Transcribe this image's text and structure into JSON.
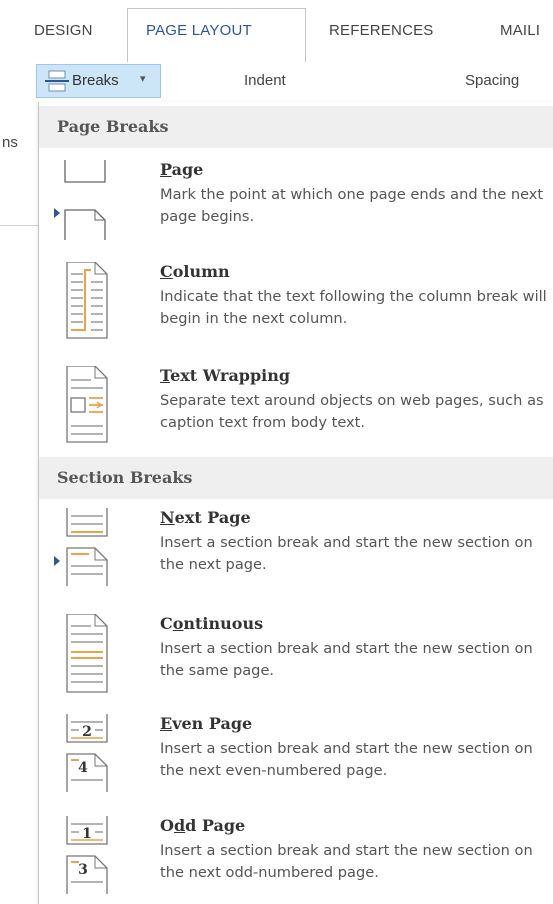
{
  "ribbon": {
    "tabs": [
      {
        "label": "DESIGN"
      },
      {
        "label": "PAGE LAYOUT"
      },
      {
        "label": "REFERENCES"
      },
      {
        "label": "MAILI"
      }
    ],
    "breaks_label": "Breaks",
    "breaks_caret": "▾",
    "indent_label": "Indent",
    "spacing_label": "Spacing",
    "left_cut_text": "ns"
  },
  "menu": {
    "page_breaks_header": "Page Breaks",
    "section_breaks_header": "Section Breaks",
    "items": [
      {
        "title_u": "P",
        "title_rest": "age",
        "desc": "Mark the point at which one page ends and the next page begins.",
        "icon": "page-break-icon"
      },
      {
        "title_u": "C",
        "title_rest": "olumn",
        "desc": "Indicate that the text following the column break will begin in the next column.",
        "icon": "column-break-icon"
      },
      {
        "title_u": "T",
        "title_rest": "ext Wrapping",
        "desc": "Separate text around objects on web pages, such as caption text from body text.",
        "icon": "text-wrapping-icon"
      },
      {
        "title_u": "N",
        "title_rest": "ext Page",
        "desc": "Insert a section break and start the new section on the next page.",
        "icon": "next-page-icon"
      },
      {
        "title_pre": "C",
        "title_u": "o",
        "title_rest": "ntinuous",
        "desc": "Insert a section break and start the new section on the same page.",
        "icon": "continuous-icon"
      },
      {
        "title_u": "E",
        "title_rest": "ven Page",
        "desc": "Insert a section break and start the new section on the next even-numbered page.",
        "icon": "even-page-icon"
      },
      {
        "title_pre": "O",
        "title_u": "d",
        "title_rest": "d Page",
        "desc": "Insert a section break and start the new section on the next odd-numbered page.",
        "icon": "odd-page-icon"
      }
    ],
    "icon_numbers": {
      "even_top": "2",
      "even_bottom": "4",
      "odd_top": "1",
      "odd_bottom": "3"
    }
  },
  "colors": {
    "accent": "#2b579a",
    "orange": "#e8a44a",
    "selected_bg": "#cde6f7",
    "header_bg": "#efefef"
  }
}
